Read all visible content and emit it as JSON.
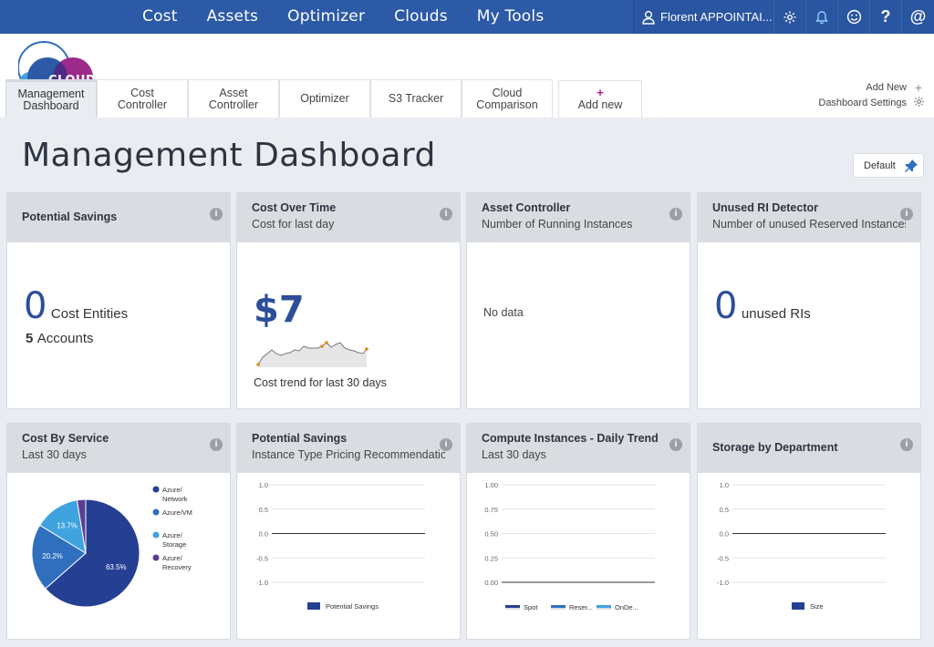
{
  "nav": {
    "items": [
      "Cost",
      "Assets",
      "Optimizer",
      "Clouds",
      "My Tools"
    ]
  },
  "user": {
    "name": "Florent APPOINTAI..."
  },
  "userbar_icons": [
    "gear-icon",
    "bell-icon",
    "smiley-icon",
    "help-icon",
    "at-icon"
  ],
  "brand": {
    "logo_text": "CLOUDYN",
    "primary": "#2c5aa6",
    "accent": "#b0208c"
  },
  "tabs": [
    {
      "l1": "Management",
      "l2": "Dashboard"
    },
    {
      "l1": "Cost",
      "l2": "Controller"
    },
    {
      "l1": "Asset",
      "l2": "Controller"
    },
    {
      "l1": "Optimizer",
      "l2": ""
    },
    {
      "l1": "S3 Tracker",
      "l2": ""
    },
    {
      "l1": "Cloud",
      "l2": "Comparison"
    }
  ],
  "add_tab": {
    "plus": "+",
    "label": "Add new"
  },
  "header_actions": {
    "add_new": "Add New",
    "dashboard_settings": "Dashboard Settings"
  },
  "page": {
    "title": "Management Dashboard",
    "default_label": "Default"
  },
  "cards": {
    "potential_savings": {
      "title": "Potential Savings",
      "count": "0",
      "count_label": "Cost Entities",
      "accounts": "5",
      "accounts_label": "Accounts"
    },
    "cost_over_time": {
      "title": "Cost Over Time",
      "sub": "Cost for last day",
      "value": "$7",
      "trend_label": "Cost trend for last 30 days"
    },
    "asset_controller": {
      "title": "Asset Controller",
      "sub": "Number of Running Instances",
      "empty": "No data"
    },
    "unused_ri": {
      "title": "Unused RI Detector",
      "sub": "Number of unused Reserved Instances",
      "value": "0",
      "value_label": "unused RIs"
    },
    "cost_by_service": {
      "title": "Cost By Service",
      "sub": "Last 30 days"
    },
    "potential_savings_2": {
      "title": "Potential Savings",
      "sub": "Instance Type Pricing Recommendations"
    },
    "compute_instances": {
      "title": "Compute Instances - Daily Trend",
      "sub": "Last 30 days"
    },
    "storage_by_dept": {
      "title": "Storage by Department"
    }
  },
  "chart_data": [
    {
      "type": "pie",
      "title": "Cost By Service",
      "categories": [
        "Azure/ Network",
        "Azure/VM",
        "Azure/ Storage",
        "Azure/ Recovery"
      ],
      "values": [
        63.5,
        20.2,
        13.7,
        2.6
      ],
      "value_labels": [
        "63.5%",
        "20.2%",
        "13.7%",
        ""
      ],
      "colors": [
        "#253f93",
        "#2f6fbe",
        "#3fa3df",
        "#5c3f93"
      ]
    },
    {
      "type": "bar",
      "title": "Potential Savings",
      "series": [
        {
          "name": "Potential Savings",
          "values": []
        }
      ],
      "yticks": [
        "1.0",
        "0.5",
        "0.0",
        "-0.5",
        "-1.0"
      ],
      "ylim": [
        -1,
        1
      ]
    },
    {
      "type": "line",
      "title": "Compute Instances - Daily Trend",
      "series": [
        {
          "name": "Spot",
          "values": []
        },
        {
          "name": "Reser...",
          "values": []
        },
        {
          "name": "OnDe...",
          "values": []
        }
      ],
      "yticks": [
        "1.00",
        "0.75",
        "0.50",
        "0.25",
        "0.00"
      ],
      "ylim": [
        0,
        1
      ]
    },
    {
      "type": "bar",
      "title": "Storage by Department",
      "series": [
        {
          "name": "Size",
          "values": []
        }
      ],
      "yticks": [
        "1.0",
        "0.5",
        "0.0",
        "-0.5",
        "-1.0"
      ],
      "ylim": [
        -1,
        1
      ]
    }
  ]
}
